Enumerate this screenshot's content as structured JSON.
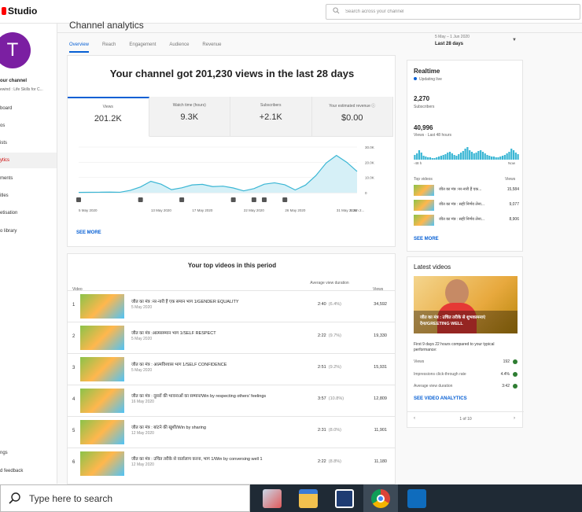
{
  "topbar": {
    "logo": "Studio",
    "search_placeholder": "Search across your channel"
  },
  "sidebar": {
    "avatar_letter": "T",
    "channel_title": "our channel",
    "channel_sub": "ewind : Life Skills for C...",
    "items": [
      {
        "label": "board"
      },
      {
        "label": "os"
      },
      {
        "label": "ists"
      },
      {
        "label": "ytics"
      },
      {
        "label": "ments"
      },
      {
        "label": "itles"
      },
      {
        "label": "etisation"
      },
      {
        "label": "o library"
      }
    ],
    "bottom_items": [
      {
        "label": "ngs"
      },
      {
        "label": "d feedback"
      }
    ]
  },
  "header": {
    "page_title": "Channel analytics",
    "tabs": [
      "Overview",
      "Reach",
      "Engagement",
      "Audience",
      "Revenue"
    ],
    "range_dates": "5 May – 1 Jun 2020",
    "range_label": "Last 28 days"
  },
  "overview": {
    "headline": "Your channel got 201,230 views in the last 28 days",
    "metrics": [
      {
        "label": "Views",
        "value": "201.2K"
      },
      {
        "label": "Watch time (hours)",
        "value": "9.3K"
      },
      {
        "label": "Subscribers",
        "value": "+2.1K"
      },
      {
        "label": "Your estimated revenue ⓘ",
        "value": "$0.00"
      }
    ],
    "see_more": "SEE MORE"
  },
  "chart_data": {
    "type": "area",
    "x": [
      "5 May",
      "6 May",
      "7 May",
      "8 May",
      "9 May",
      "10 May",
      "11 May",
      "12 May",
      "13 May",
      "14 May",
      "15 May",
      "16 May",
      "17 May",
      "18 May",
      "19 May",
      "20 May",
      "21 May",
      "22 May",
      "23 May",
      "24 May",
      "25 May",
      "26 May",
      "27 May",
      "28 May",
      "29 May",
      "30 May",
      "31 May",
      "1 Jun"
    ],
    "values": [
      200,
      250,
      300,
      400,
      300,
      1500,
      3800,
      7500,
      5600,
      2000,
      3200,
      5100,
      5500,
      4000,
      4300,
      3100,
      1200,
      2700,
      5600,
      6500,
      5200,
      1800,
      5000,
      11200,
      19500,
      24500,
      20000,
      14000
    ],
    "x_tick_labels": [
      "5 May 2020",
      "13 May 2020",
      "17 May 2020",
      "22 May 2020",
      "26 May 2020",
      "31 May 2020",
      "1 Jun 2..."
    ],
    "y_tick_labels": [
      "0",
      "10.0K",
      "20.0K",
      "30.0K"
    ],
    "ylim": [
      0,
      30000
    ],
    "grid": true
  },
  "top_videos": {
    "title": "Your top videos in this period",
    "col_video": "Video",
    "col_avd": "Average view duration",
    "col_views": "Views",
    "rows": [
      {
        "rank": "1",
        "title": "जीत का मंत्र :नर-नारी हैं एक समान भाग 1/GENDER EQUALITY",
        "date": "5 May 2020",
        "duration": "2:40",
        "pct": "(6.4%)",
        "views": "34,592"
      },
      {
        "rank": "2",
        "title": "जीत का मंत्र :आत्मसम्मान भाग 1/SELF RESPECT",
        "date": "5 May 2020",
        "duration": "2:22",
        "pct": "(9.7%)",
        "views": "19,330"
      },
      {
        "rank": "3",
        "title": "जीत का मंत्र : आत्मविश्वास भाग 1/SELF CONFIDENCE",
        "date": "5 May 2020",
        "duration": "2:51",
        "pct": "(9.2%)",
        "views": "15,931"
      },
      {
        "rank": "4",
        "title": "जीत का मंत्र : दूसरों की भावनाओं का सम्मान/Win by respecting others' feelings",
        "date": "16 May 2020",
        "duration": "3:57",
        "pct": "(10.8%)",
        "views": "12,809"
      },
      {
        "rank": "5",
        "title": "जीत का मंत्र : बांटने की खुशी/Win by sharing",
        "date": "12 May 2020",
        "duration": "2:31",
        "pct": "(8.0%)",
        "views": "11,901"
      },
      {
        "rank": "6",
        "title": "जीत का मंत्र : उचित तरीके से वार्तालाप करना, भाग 1/Win by conversing well 1",
        "date": "12 May 2020",
        "duration": "2:22",
        "pct": "(8.8%)",
        "views": "11,180"
      }
    ]
  },
  "realtime": {
    "title": "Realtime",
    "live": "Updating live",
    "subs_value": "2,270",
    "subs_label": "Subscribers",
    "views_value": "40,996",
    "views_label": "Views · Last 48 hours",
    "bars_start": "-48 h",
    "bars_end": "Now",
    "top_label": "Top videos",
    "views_col": "Views",
    "top": [
      {
        "title": "जीत का मंत्र :नर-नारी हैं एक...",
        "views": "15,584"
      },
      {
        "title": "जीत का मंत्र : सही निर्णय लेना...",
        "views": "9,077"
      },
      {
        "title": "जीत का मंत्र : सही निर्णय लेना...",
        "views": "8,906"
      }
    ],
    "see_more": "SEE MORE"
  },
  "latest": {
    "title": "Latest videos",
    "thumb_text": "जीत का मंत्र : उचित तरीके से शुभकामनाएं देना/GREETING WELL",
    "compare": "First 9 days 22 hours compared to your typical performance:",
    "stats": [
      {
        "label": "Views",
        "value": "192"
      },
      {
        "label": "Impressions click-through rate",
        "value": "4.4%"
      },
      {
        "label": "Average view duration",
        "value": "3:42"
      }
    ],
    "see_analytics": "SEE VIDEO ANALYTICS",
    "pager": "1 of 10"
  },
  "taskbar": {
    "search_text": "Type here to search"
  },
  "colors": {
    "accent": "#065fd4",
    "chart_line": "#3ab6d4",
    "chart_fill": "#d6f0f7",
    "avatar": "#7b1fa2",
    "positive": "#2e7d32"
  }
}
